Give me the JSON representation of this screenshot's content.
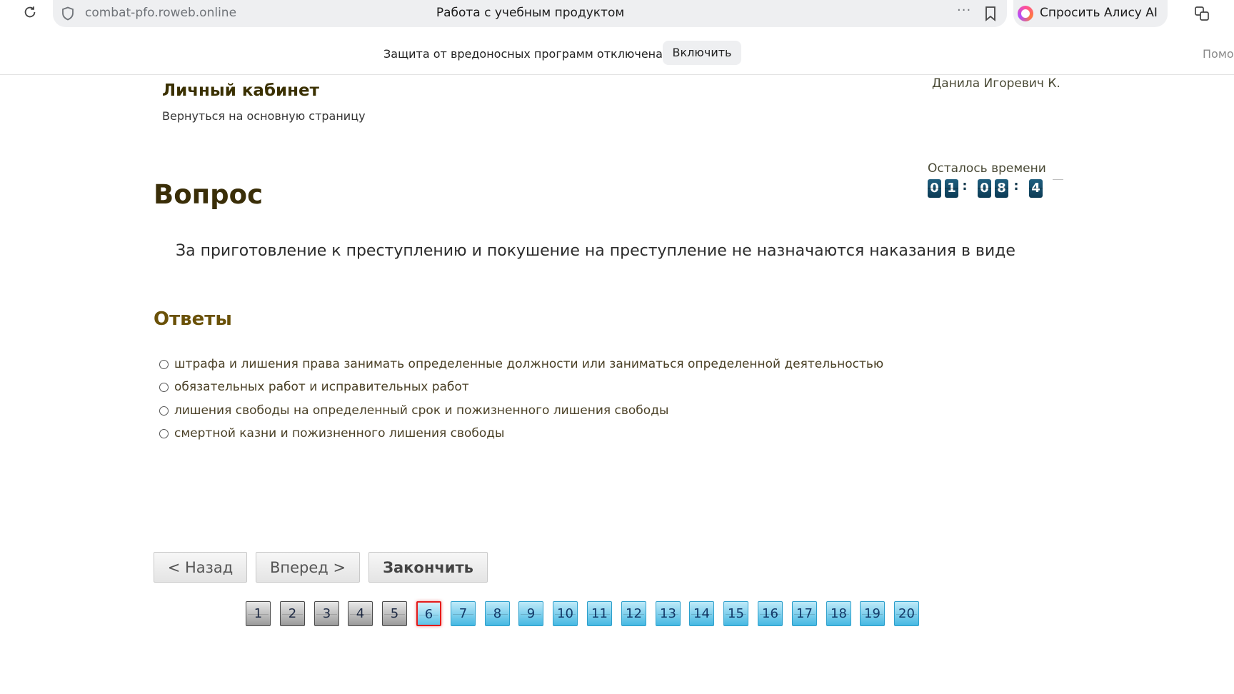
{
  "browser": {
    "url": "combat-pfo.roweb.online",
    "page_title": "Работа с учебным продуктом",
    "menu_dots": "···",
    "alice_label": "Спросить Алису AI",
    "infobar_text": "Защита от вредоносных программ отключена",
    "enable_button": "Включить",
    "help_text": "Помо"
  },
  "header": {
    "cabinet_title": "Личный кабинет",
    "back_link": "Вернуться на основную страницу",
    "user_name": "Данила Игоревич К."
  },
  "timer": {
    "label": "Осталось времени",
    "d1": "0",
    "d2": "1",
    "sep1": ":",
    "d3": "0",
    "d4": "8",
    "sep2": ":",
    "d5": "4"
  },
  "question": {
    "heading": "Вопрос",
    "text": "За приготовление к преступлению и покушение на преступление не назначаются наказания в виде"
  },
  "answers": {
    "heading": "Ответы",
    "items": [
      "штрафа и лишения права занимать определенные должности или заниматься определенной деятельностью",
      "обязательных работ и исправительных работ",
      "лишения свободы на определенный срок и пожизненного лишения свободы",
      "смертной казни и пожизненного лишения свободы"
    ]
  },
  "nav": {
    "back": "< Назад",
    "forward": "Вперед >",
    "finish": "Закончить"
  },
  "pages": {
    "items": [
      "1",
      "2",
      "3",
      "4",
      "5",
      "6",
      "7",
      "8",
      "9",
      "10",
      "11",
      "12",
      "13",
      "14",
      "15",
      "16",
      "17",
      "18",
      "19",
      "20"
    ],
    "current": "6",
    "answered": [
      "1",
      "2",
      "3",
      "4",
      "5"
    ]
  },
  "colors": {
    "heading_dark": "#3a2e08",
    "answers_heading": "#6a5108",
    "timer_digit": "#0c3b55",
    "page_todo": "#45b8e2",
    "page_current_border": "#e31b1b"
  }
}
